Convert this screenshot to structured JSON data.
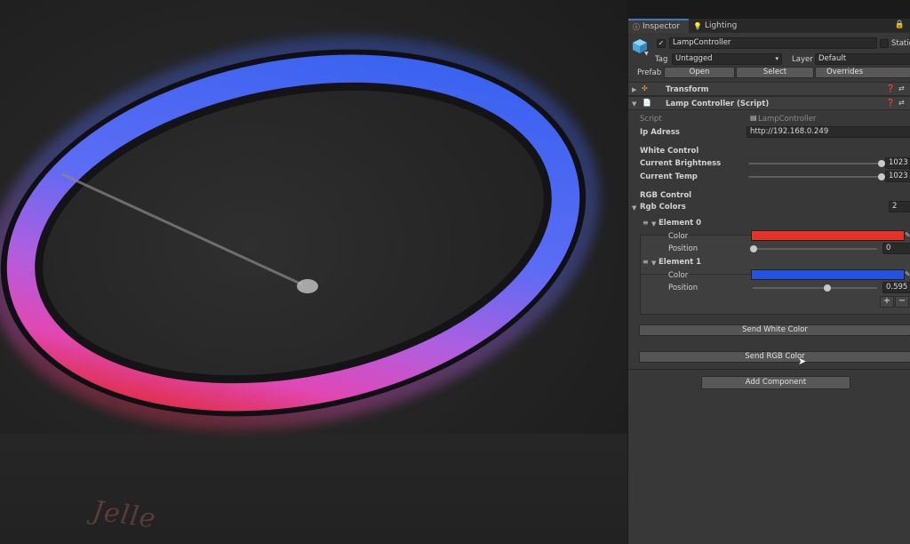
{
  "photo": {
    "wall_text": "Jelle"
  },
  "inspector": {
    "tabs": [
      {
        "label": "Inspector",
        "icon": "info-icon"
      },
      {
        "label": "Lighting",
        "icon": "lightbulb-icon"
      }
    ],
    "object": {
      "name": "LampController",
      "active": true,
      "static_label": "Static",
      "tag_label": "Tag",
      "tag_value": "Untagged",
      "layer_label": "Layer",
      "layer_value": "Default",
      "prefab_label": "Prefab",
      "prefab_open": "Open",
      "prefab_select": "Select",
      "prefab_overrides": "Overrides"
    },
    "components": {
      "transform_title": "Transform",
      "script_title": "Lamp Controller (Script)"
    },
    "script": {
      "script_label": "Script",
      "script_value": "LampController",
      "ip_label": "Ip Adress",
      "ip_value": "http://192.168.0.249",
      "white_control_header": "White Control",
      "brightness_label": "Current Brightness",
      "brightness_value": "1023",
      "temp_label": "Current Temp",
      "temp_value": "1023",
      "rgb_control_header": "RGB Control",
      "rgb_colors_label": "Rgb Colors",
      "rgb_colors_count": "2",
      "elements": [
        {
          "label": "Element 0",
          "color_label": "Color",
          "color": "#e5332a",
          "position_label": "Position",
          "position_value": "0"
        },
        {
          "label": "Element 1",
          "color_label": "Color",
          "color": "#2453e0",
          "position_label": "Position",
          "position_value": "0.595"
        }
      ],
      "add_symbol": "+",
      "remove_symbol": "−",
      "send_white_button": "Send White Color",
      "send_rgb_button": "Send RGB Color",
      "add_component_button": "Add Component"
    }
  }
}
